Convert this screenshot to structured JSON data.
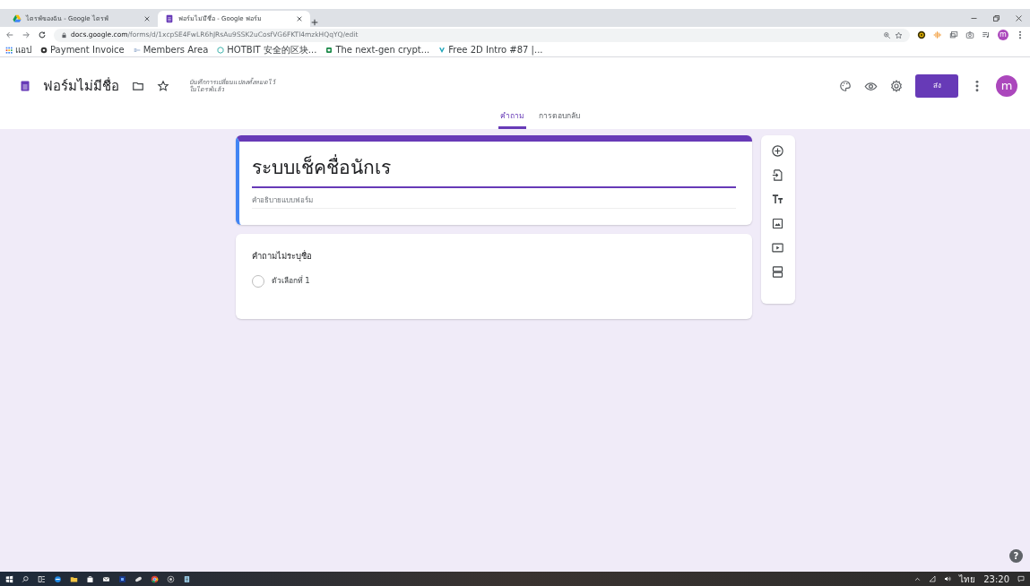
{
  "browser": {
    "tabs": [
      {
        "title": "ไดรฟ์ของฉัน - Google ไดรฟ์",
        "selected": false
      },
      {
        "title": "ฟอร์มไม่มีชื่อ - Google ฟอร์ม",
        "selected": true
      }
    ],
    "url_host": "docs.google.com",
    "url_path": "/forms/d/1xcpSE4FwLR6hJRsAu9SSK2uCosfVG6FKTl4mzkHQqYQ/edit",
    "bookmarks": [
      "แอป",
      "Payment Invoice",
      "Members Area",
      "HOTBIT 安全的区块...",
      "The next-gen crypt...",
      "Free 2D Intro #87 |..."
    ],
    "profile": "m"
  },
  "app": {
    "title": "ฟอร์มไม่มีชื่อ",
    "save_status": [
      "บันทึกการเปลี่ยนแปลงทั้งหมดไว้",
      "ในไดรฟ์แล้ว"
    ],
    "send_button": "ส่ง",
    "avatar": "m",
    "tabs": [
      {
        "label": "คำถาม",
        "selected": true
      },
      {
        "label": "การตอบกลับ",
        "selected": false
      }
    ]
  },
  "form": {
    "title": "ระบบเช็คชื่อนักเร",
    "description_placeholder": "คำอธิบายแบบฟอร์ม",
    "questions": [
      {
        "title": "คำถามไม่ระบุชื่อ",
        "options": [
          {
            "label": "ตัวเลือกที่ 1",
            "selected": false
          }
        ]
      }
    ]
  },
  "help": "?",
  "taskbar": {
    "language": "ไทย",
    "time": "23:20"
  }
}
